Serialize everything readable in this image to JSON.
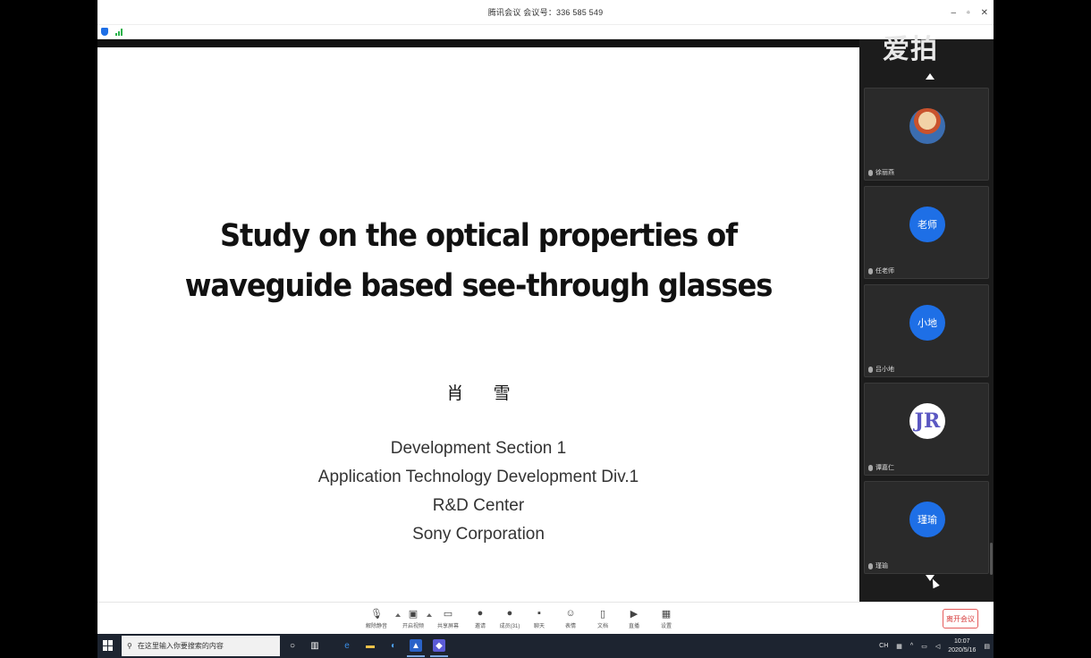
{
  "window": {
    "title": "腾讯会议 会议号：336 585 549",
    "controls": {
      "minimize": "–",
      "maximize": "▫",
      "close": "✕"
    }
  },
  "watermark": "爱拍",
  "slide": {
    "title_line1": "Study on the optical properties of",
    "title_line2": "waveguide based see-through glasses",
    "author": "肖 雪",
    "affiliation": [
      "Development Section 1",
      "Application Technology Development Div.1",
      "R&D Center",
      "Sony Corporation"
    ]
  },
  "participants": [
    {
      "name": "徐丽燕",
      "avatar_text": "",
      "avatar_type": "photo"
    },
    {
      "name": "任老师",
      "avatar_text": "老师",
      "avatar_type": "initials"
    },
    {
      "name": "吕小地",
      "avatar_text": "小地",
      "avatar_type": "initials"
    },
    {
      "name": "谭嘉仁",
      "avatar_text": "JR",
      "avatar_type": "logo"
    },
    {
      "name": "瑾瑜",
      "avatar_text": "瑾瑜",
      "avatar_type": "initials"
    }
  ],
  "toolbar": {
    "items": [
      {
        "label": "解除静音",
        "icon": "microphone-icon"
      },
      {
        "label": "开启视频",
        "icon": "camera-off-icon"
      },
      {
        "label": "共享屏幕",
        "icon": "share-screen-icon"
      },
      {
        "label": "邀请",
        "icon": "invite-icon"
      },
      {
        "label": "成员(31)",
        "icon": "members-icon"
      },
      {
        "label": "聊天",
        "icon": "chat-icon"
      },
      {
        "label": "表情",
        "icon": "emoji-icon"
      },
      {
        "label": "文档",
        "icon": "document-icon"
      },
      {
        "label": "直播",
        "icon": "live-icon"
      },
      {
        "label": "设置",
        "icon": "settings-icon"
      }
    ],
    "leave_label": "离开会议"
  },
  "taskbar": {
    "search_placeholder": "在这里输入你要搜索的内容",
    "ime": "CH",
    "time": "10:07",
    "date": "2020/5/16"
  },
  "colors": {
    "accent": "#1e6fe6",
    "danger": "#d73b3b"
  }
}
